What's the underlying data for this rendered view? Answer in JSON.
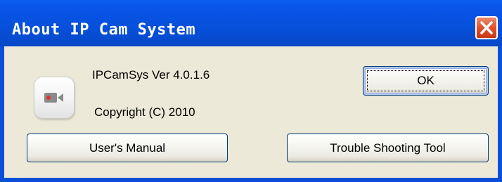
{
  "window": {
    "title": "About IP Cam System"
  },
  "info": {
    "version": "IPCamSys Ver 4.0.1.6",
    "copyright": "Copyright (C) 2010"
  },
  "buttons": {
    "ok": "OK",
    "manual": "User's Manual",
    "troubleshoot": "Trouble Shooting Tool"
  },
  "icons": {
    "app": "video-camera-icon",
    "close": "close-icon"
  },
  "colors": {
    "titlebar": "#0a54e8",
    "close_button": "#e2512b",
    "client_background": "#ece9d8",
    "camera_red": "#e0342b",
    "camera_gray": "#8a8a8a"
  }
}
